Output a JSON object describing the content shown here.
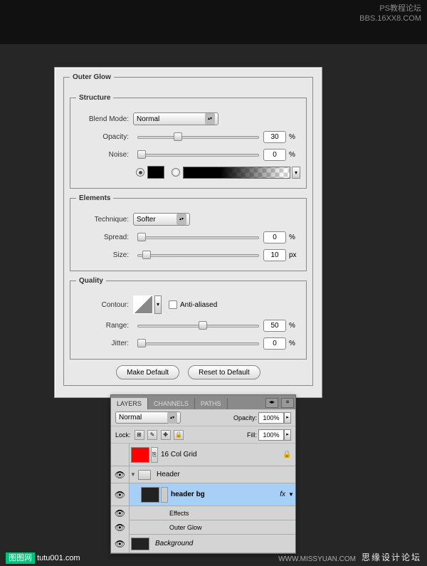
{
  "watermarks": {
    "top1": "PS教程论坛",
    "top2": "BBS.16XX8.COM",
    "bl_tag": "图图网",
    "bl_url": "tutu001.com",
    "br": "思缘设计论坛",
    "br2": "WWW.MISSYUAN.COM"
  },
  "outerGlow": {
    "title": "Outer Glow",
    "structure": {
      "legend": "Structure",
      "blendModeLabel": "Blend Mode:",
      "blendMode": "Normal",
      "opacityLabel": "Opacity:",
      "opacity": "30",
      "opacityUnit": "%",
      "noiseLabel": "Noise:",
      "noise": "0",
      "noiseUnit": "%"
    },
    "elements": {
      "legend": "Elements",
      "techniqueLabel": "Technique:",
      "technique": "Softer",
      "spreadLabel": "Spread:",
      "spread": "0",
      "spreadUnit": "%",
      "sizeLabel": "Size:",
      "size": "10",
      "sizeUnit": "px"
    },
    "quality": {
      "legend": "Quality",
      "contourLabel": "Contour:",
      "antiAliased": "Anti-aliased",
      "rangeLabel": "Range:",
      "range": "50",
      "rangeUnit": "%",
      "jitterLabel": "Jitter:",
      "jitter": "0",
      "jitterUnit": "%"
    },
    "buttons": {
      "makeDefault": "Make Default",
      "reset": "Reset to Default"
    }
  },
  "layersPanel": {
    "tabs": {
      "layers": "LAYERS",
      "channels": "CHANNELS",
      "paths": "PATHS"
    },
    "blendMode": "Normal",
    "opacityLabel": "Opacity:",
    "opacity": "100%",
    "lockLabel": "Lock:",
    "fillLabel": "Fill:",
    "fill": "100%",
    "layers": [
      {
        "name": "16 Col Grid"
      },
      {
        "name": "Header"
      },
      {
        "name": "header bg",
        "fx": "fx"
      },
      {
        "effects": "Effects"
      },
      {
        "effectItem": "Outer Glow"
      },
      {
        "name": "Background"
      }
    ]
  }
}
